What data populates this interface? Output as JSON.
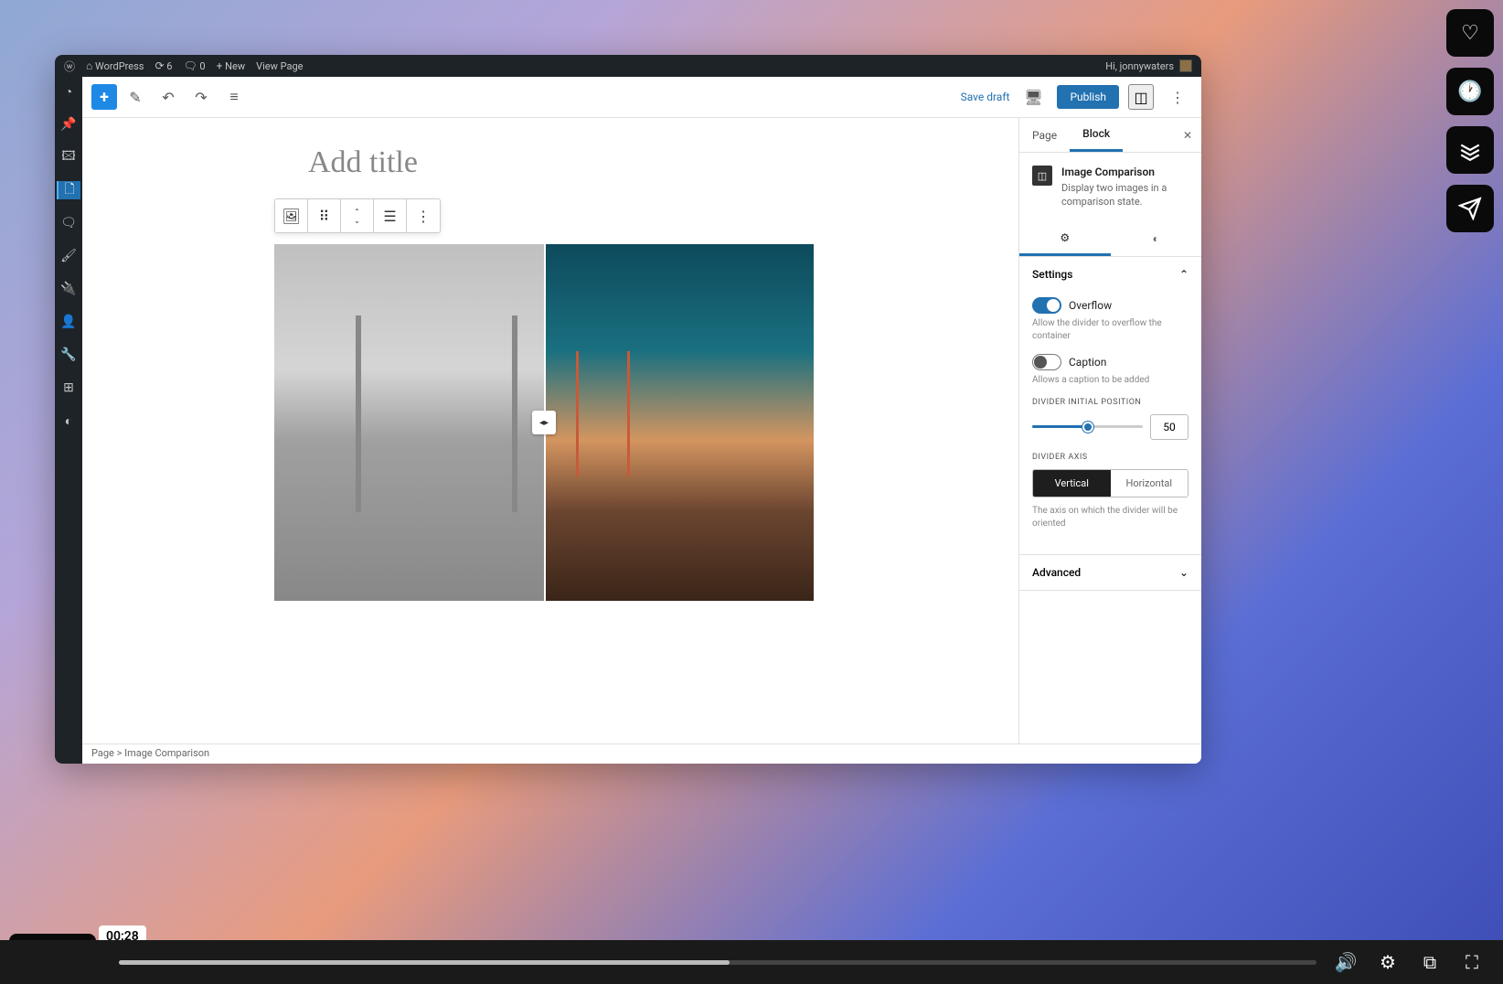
{
  "admin_bar": {
    "site_name": "WordPress",
    "updates": "6",
    "comments": "0",
    "new": "New",
    "view_page": "View Page",
    "greeting": "Hi, jonnywaters"
  },
  "toolbar": {
    "save_draft": "Save draft",
    "publish": "Publish"
  },
  "canvas": {
    "title_placeholder": "Add title"
  },
  "breadcrumb": {
    "path": "Page > Image Comparison"
  },
  "right_panel": {
    "tab_page": "Page",
    "tab_block": "Block",
    "block_title": "Image Comparison",
    "block_desc": "Display two images in a comparison state.",
    "section_settings": "Settings",
    "overflow_label": "Overflow",
    "overflow_help": "Allow the divider to overflow the container",
    "caption_label": "Caption",
    "caption_help": "Allows a caption to be added",
    "divider_pos_label": "DIVIDER INITIAL POSITION",
    "divider_pos_value": "50",
    "divider_axis_label": "DIVIDER AXIS",
    "axis_vertical": "Vertical",
    "axis_horizontal": "Horizontal",
    "axis_help": "The axis on which the divider will be oriented",
    "section_advanced": "Advanced"
  },
  "video": {
    "time": "00:28"
  }
}
